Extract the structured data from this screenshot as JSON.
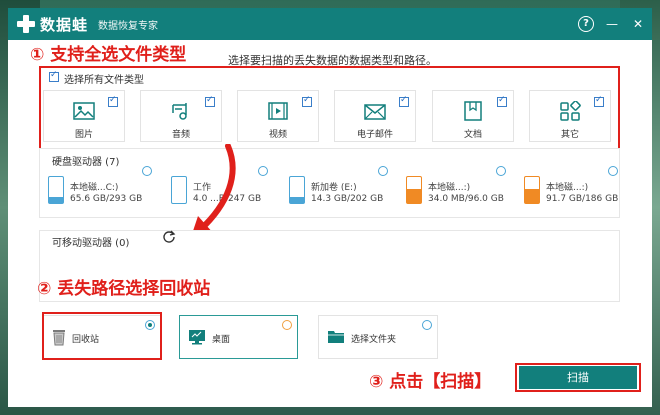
{
  "app": {
    "name": "数据蛙",
    "subtitle": "数据恢复专家"
  },
  "titlebar": {
    "help": "?",
    "minimize": "—",
    "close": "✕"
  },
  "annotations": {
    "step1": "① 支持全选文件类型",
    "step2": "② 丢失路径选择回收站",
    "step3": "③ 点击【扫描】"
  },
  "prompt": "选择要扫描的丢失数据的数据类型和路径。",
  "select_all": {
    "label": "选择所有文件类型",
    "checked": true
  },
  "file_types": [
    {
      "label": "图片",
      "icon": "image-icon",
      "checked": true
    },
    {
      "label": "音频",
      "icon": "music-icon",
      "checked": true
    },
    {
      "label": "视频",
      "icon": "video-icon",
      "checked": true
    },
    {
      "label": "电子邮件",
      "icon": "email-icon",
      "checked": true
    },
    {
      "label": "文档",
      "icon": "document-icon",
      "checked": true
    },
    {
      "label": "其它",
      "icon": "other-icon",
      "checked": true
    }
  ],
  "hard_drives": {
    "title": "硬盘驱动器 (7)",
    "items": [
      {
        "name": "本地磁...C:)",
        "size": "65.6 GB/293 GB"
      },
      {
        "name": "工作",
        "size": "4.0 ...B/247 GB"
      },
      {
        "name": "新加卷 (E:)",
        "size": "14.3 GB/202 GB"
      },
      {
        "name": "本地磁...:)",
        "size": "34.0 MB/96.0 GB"
      },
      {
        "name": "本地磁...:)",
        "size": "91.7 GB/186 GB"
      }
    ]
  },
  "removable": {
    "title": "可移动驱动器 (0)"
  },
  "locations": [
    {
      "label": "回收站",
      "icon": "recycle-bin-icon",
      "selected": true
    },
    {
      "label": "桌面",
      "icon": "desktop-icon",
      "selected": false
    },
    {
      "label": "选择文件夹",
      "icon": "folder-icon",
      "selected": false
    }
  ],
  "scan_button": "扫描",
  "colors": {
    "primary": "#127f7c",
    "annotation": "#e0201b",
    "drive_blue": "#4aa5d6",
    "drive_orange": "#f08a24"
  }
}
